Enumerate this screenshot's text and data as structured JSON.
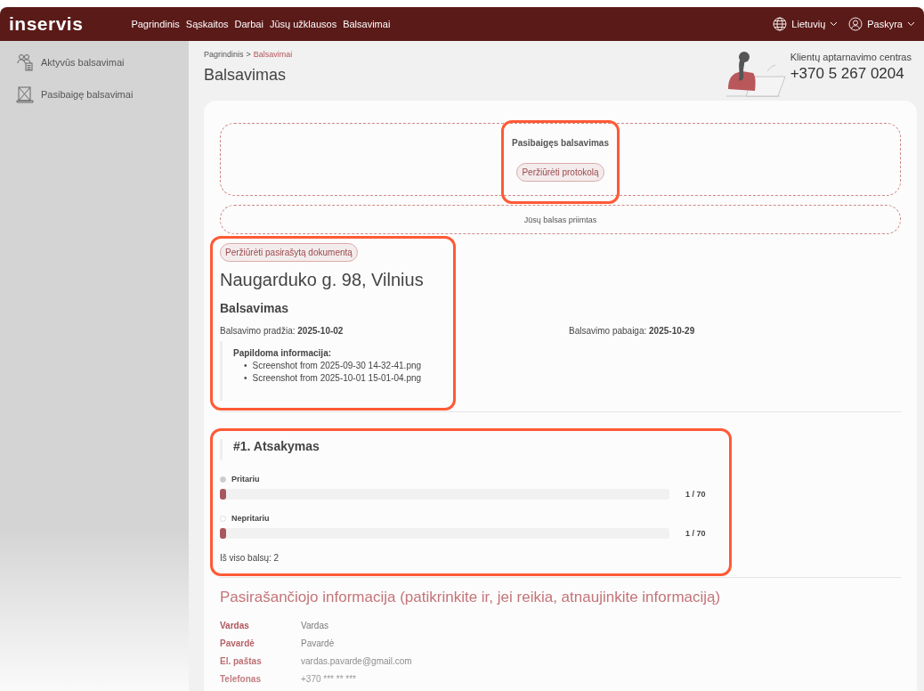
{
  "topbar": {
    "logo": "inservis",
    "nav": [
      {
        "label": "Pagrindinis"
      },
      {
        "label": "Sąskaitos"
      },
      {
        "label": "Darbai"
      },
      {
        "label": "Jūsų užklausos"
      },
      {
        "label": "Balsavimai"
      }
    ],
    "language": "Lietuvių",
    "account": "Paskyra"
  },
  "sidebar": {
    "items": [
      {
        "label": "Aktyvūs balsavimai",
        "kind": "active"
      },
      {
        "label": "Pasibaigę balsavimai",
        "kind": "ended"
      }
    ]
  },
  "breadcrumb": [
    {
      "label": "Pagrindinis",
      "current": false
    },
    {
      "label": "Balsavimai",
      "current": true
    }
  ],
  "breadcrumb_separator": ">",
  "page_title": "Balsavimas",
  "helpline": {
    "label": "Klientų aptarnavimo centras",
    "phone": "+370 5 267 0204"
  },
  "status_box": {
    "title": "Pasibaigęs balsavimas",
    "button": "Peržiūrėti protokolą",
    "highlighted": true
  },
  "vote_notice": "Jūsų balsas priimtas",
  "document": {
    "button": "Peržiūrėti pasirašytą dokumentą",
    "address": "Naugarduko g. 98, Vilnius",
    "subtitle": "Balsavimas",
    "start_label": "Balsavimo pradžia:",
    "start": "2025-10-02",
    "end_label": "Balsavimo pabaiga:",
    "end": "2025-10-29",
    "info_title": "Papildoma informacija:",
    "bullet": "•",
    "attachments": [
      "Screenshot from 2025-09-30 14-32-41.png",
      "Screenshot from 2025-10-01 15-01-04.png"
    ],
    "highlighted": true
  },
  "question": {
    "title": "#1. Atsakymas",
    "highlighted": true,
    "options": [
      {
        "label": "Pritariu",
        "selected": true,
        "level": 0.014,
        "count": "1 / 70"
      },
      {
        "label": "Nepritariu",
        "selected": false,
        "level": 0.014,
        "count": "1 / 70"
      }
    ],
    "total": "Iš viso balsų: 2"
  },
  "signer": {
    "title": "Pasirašančiojo informacija (patikrinkite ir, jei reikia, atnaujinkite informaciją)",
    "fields": [
      {
        "label": "Vardas",
        "value": "Vardas"
      },
      {
        "label": "Pavardė",
        "value": "Pavardė"
      },
      {
        "label": "El. paštas",
        "value": "vardas.pavarde@gmail.com"
      },
      {
        "label": "Telefonas",
        "value": "+370 *** ** ***"
      }
    ]
  }
}
